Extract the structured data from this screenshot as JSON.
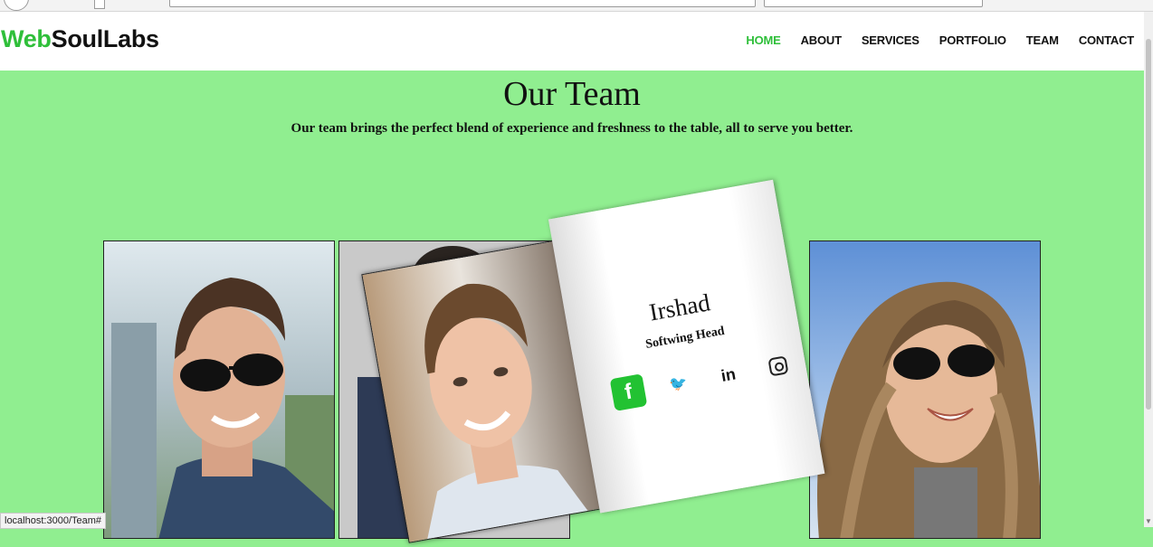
{
  "brand": {
    "part1": "Web",
    "part2": "SoulLabs"
  },
  "nav": {
    "home": "HOME",
    "about": "ABOUT",
    "services": "SERVICES",
    "portfolio": "PORTFOLIO",
    "team": "TEAM",
    "contact": "CONTACT"
  },
  "section": {
    "title": "Our Team",
    "subtitle": "Our team brings the perfect blend of experience and freshness to the table, all to serve you better."
  },
  "featured_member": {
    "name": "Irshad",
    "role": "Softwing Head",
    "socials": {
      "facebook": "f",
      "twitter": "🐦",
      "linkedin": "in"
    }
  },
  "status_url": "localhost:3000/Team#",
  "colors": {
    "accent": "#2fbf3a",
    "background": "#90ee90"
  }
}
